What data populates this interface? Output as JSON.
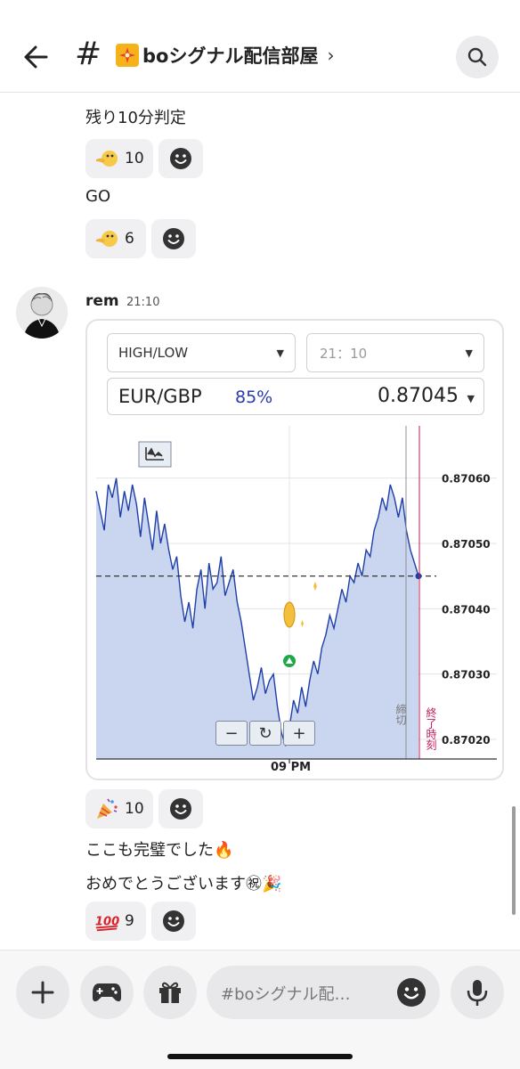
{
  "header": {
    "back_icon": "arrow-left-icon",
    "channel_prefix": "#",
    "channel_name": "boシグナル配信部屋",
    "channel_emoji": "sparkle-icon",
    "chevron": "›",
    "search_icon": "search-icon"
  },
  "messages_top": [
    {
      "text": "残り10分判定",
      "reaction_emoji": "pointing-face-icon",
      "reaction_count": "10"
    },
    {
      "text": "GO",
      "reaction_emoji": "pointing-face-icon",
      "reaction_count": "6"
    }
  ],
  "post": {
    "author": "rem",
    "time": "21:10",
    "trade": {
      "type_label": "HIGH/LOW",
      "expiry_label": "21：10",
      "pair": "EUR/GBP",
      "payout": "85%",
      "price": "0.87045"
    },
    "reaction": {
      "emoji": "party-popper-icon",
      "count": "10"
    }
  },
  "chart_data": {
    "type": "line",
    "x_tick_label": "09 PM",
    "y_ticks": [
      "0.87060",
      "0.87050",
      "0.87040",
      "0.87030",
      "0.87020"
    ],
    "ylim": [
      0.87017,
      0.87068
    ],
    "current_price": 0.87045,
    "entry_price": 0.87032,
    "vertical_labels": [
      "締切",
      "終了時刻"
    ],
    "zoom_controls": [
      "−",
      "↻",
      "+"
    ],
    "series": [
      {
        "values": [
          0.87058,
          0.87055,
          0.87052,
          0.87059,
          0.87057,
          0.8706,
          0.87054,
          0.87058,
          0.87055,
          0.87059,
          0.87056,
          0.87051,
          0.87057,
          0.87053,
          0.87049,
          0.87055,
          0.8705,
          0.87053,
          0.87049,
          0.87046,
          0.87048,
          0.87042,
          0.87038,
          0.87041,
          0.87037,
          0.87043,
          0.87046,
          0.8704,
          0.87047,
          0.87043,
          0.87044,
          0.87048,
          0.87042,
          0.87044,
          0.87046,
          0.87041,
          0.87038,
          0.87034,
          0.8703,
          0.87026,
          0.87028,
          0.87031,
          0.87027,
          0.87029,
          0.8703,
          0.87025,
          0.87021,
          0.87019,
          0.87022,
          0.87026,
          0.87024,
          0.87028,
          0.87025,
          0.87029,
          0.87032,
          0.8703,
          0.87034,
          0.87036,
          0.87039,
          0.87037,
          0.8704,
          0.87043,
          0.87041,
          0.87045,
          0.87044,
          0.87047,
          0.87045,
          0.87049,
          0.87048,
          0.87052,
          0.87054,
          0.87057,
          0.87055,
          0.87059,
          0.87057,
          0.87054,
          0.87057,
          0.87052,
          0.87049,
          0.87047,
          0.87045
        ],
        "color": "#1f3fa8",
        "fill": "#cad6f0"
      }
    ]
  },
  "messages_bottom": [
    "ここも完璧でした🔥",
    "おめでとうございます㊗🎉"
  ],
  "bottom_reaction": {
    "emoji": "hundred-points-icon",
    "count": "9"
  },
  "composer": {
    "plus_icon": "plus-icon",
    "game_icon": "gamepad-icon",
    "gift_icon": "gift-icon",
    "placeholder": "#boシグナル配…",
    "emoji_icon": "smiley-icon",
    "mic_icon": "microphone-icon"
  }
}
